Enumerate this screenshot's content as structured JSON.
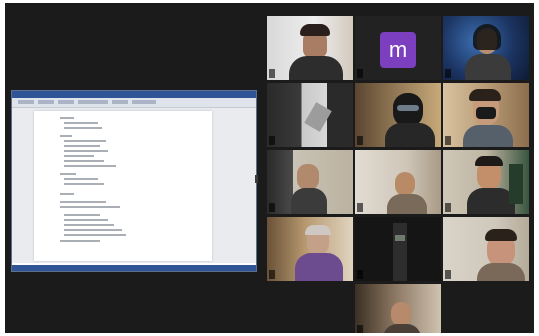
{
  "window": {
    "frame_color": "#1b1b1b",
    "active_speaker_color": "#c9d86a"
  },
  "shared_screen": {
    "app": "document editor",
    "titlebar_color": "#2f5596"
  },
  "participants": [
    {
      "name": "",
      "video": true
    },
    {
      "name": "",
      "avatar_letter": "m",
      "avatar_color": "#7b3fbf",
      "video": false
    },
    {
      "name": "",
      "video": true
    },
    {
      "name": "",
      "video": true
    },
    {
      "name": "",
      "video": true
    },
    {
      "name": "",
      "video": true
    },
    {
      "name": "",
      "video": true
    },
    {
      "name": "",
      "video": true
    },
    {
      "name": "",
      "video": true
    },
    {
      "name": "",
      "video": true
    },
    {
      "name": "",
      "video": true
    },
    {
      "name": "",
      "video": true,
      "active_speaker": true
    },
    {
      "name": "",
      "video": true
    }
  ]
}
